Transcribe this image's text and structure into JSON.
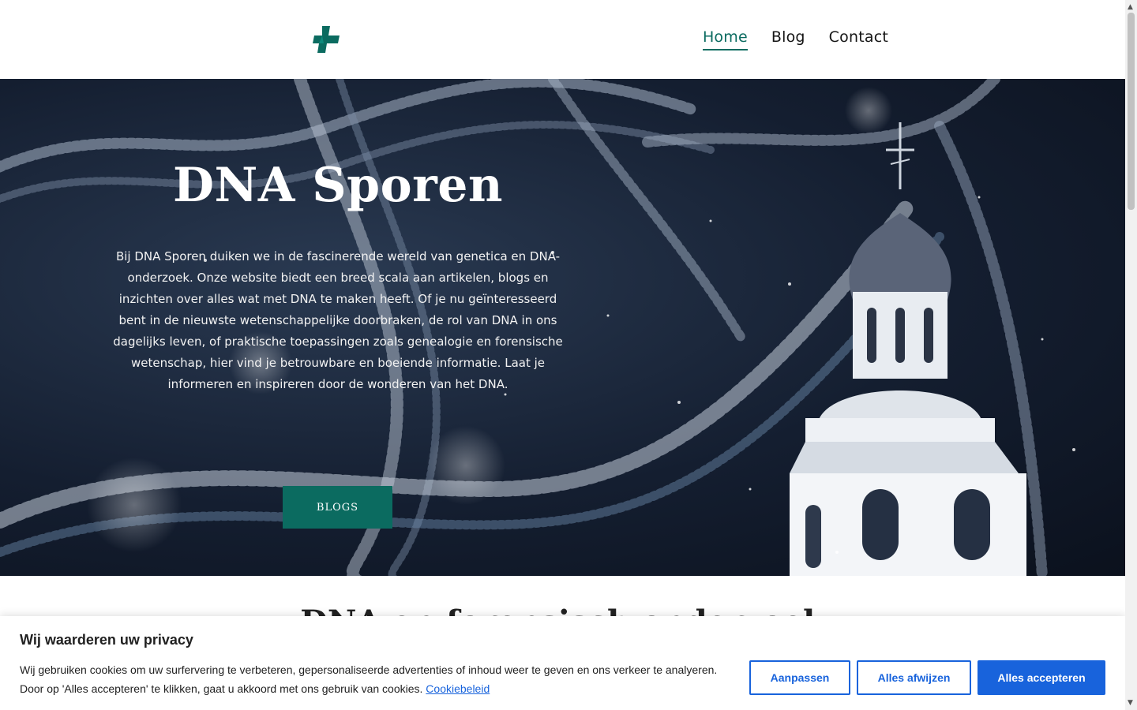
{
  "nav": {
    "items": [
      {
        "label": "Home",
        "active": true
      },
      {
        "label": "Blog",
        "active": false
      },
      {
        "label": "Contact",
        "active": false
      }
    ]
  },
  "hero": {
    "title": "DNA Sporen",
    "text": "Bij DNA Sporen duiken we in de fascinerende wereld van genetica en DNA-onderzoek. Onze website biedt een breed scala aan artikelen, blogs en inzichten over alles wat met DNA te maken heeft. Of je nu geïnteresseerd bent in de nieuwste wetenschappelijke doorbraken, de rol van DNA in ons dagelijks leven, of praktische toepassingen zoals genealogie en forensische wetenschap, hier vind je betrouwbare en boeiende informatie. Laat je informeren en inspireren door de wonderen van het DNA.",
    "button_label": "BLOGS"
  },
  "section": {
    "title_partial": "DNA en forensisch onderzoek"
  },
  "cookie": {
    "title": "Wij waarderen uw privacy",
    "text": "Wij gebruiken cookies om uw surfervering te verbeteren,  gepersonaliseerde advertenties of inhoud weer te geven en ons verkeer te analyeren. Door op 'Alles accepteren' te klikken, gaat u akkoord met ons gebruik van cookies.",
    "policy_link": "Cookiebeleid",
    "customize_label": "Aanpassen",
    "reject_label": "Alles afwijzen",
    "accept_label": "Alles accepteren"
  },
  "colors": {
    "brand": "#0b6b60",
    "cookie_accent": "#1863dc"
  },
  "icons": {
    "logo": "teal-plus-cross-icon"
  }
}
